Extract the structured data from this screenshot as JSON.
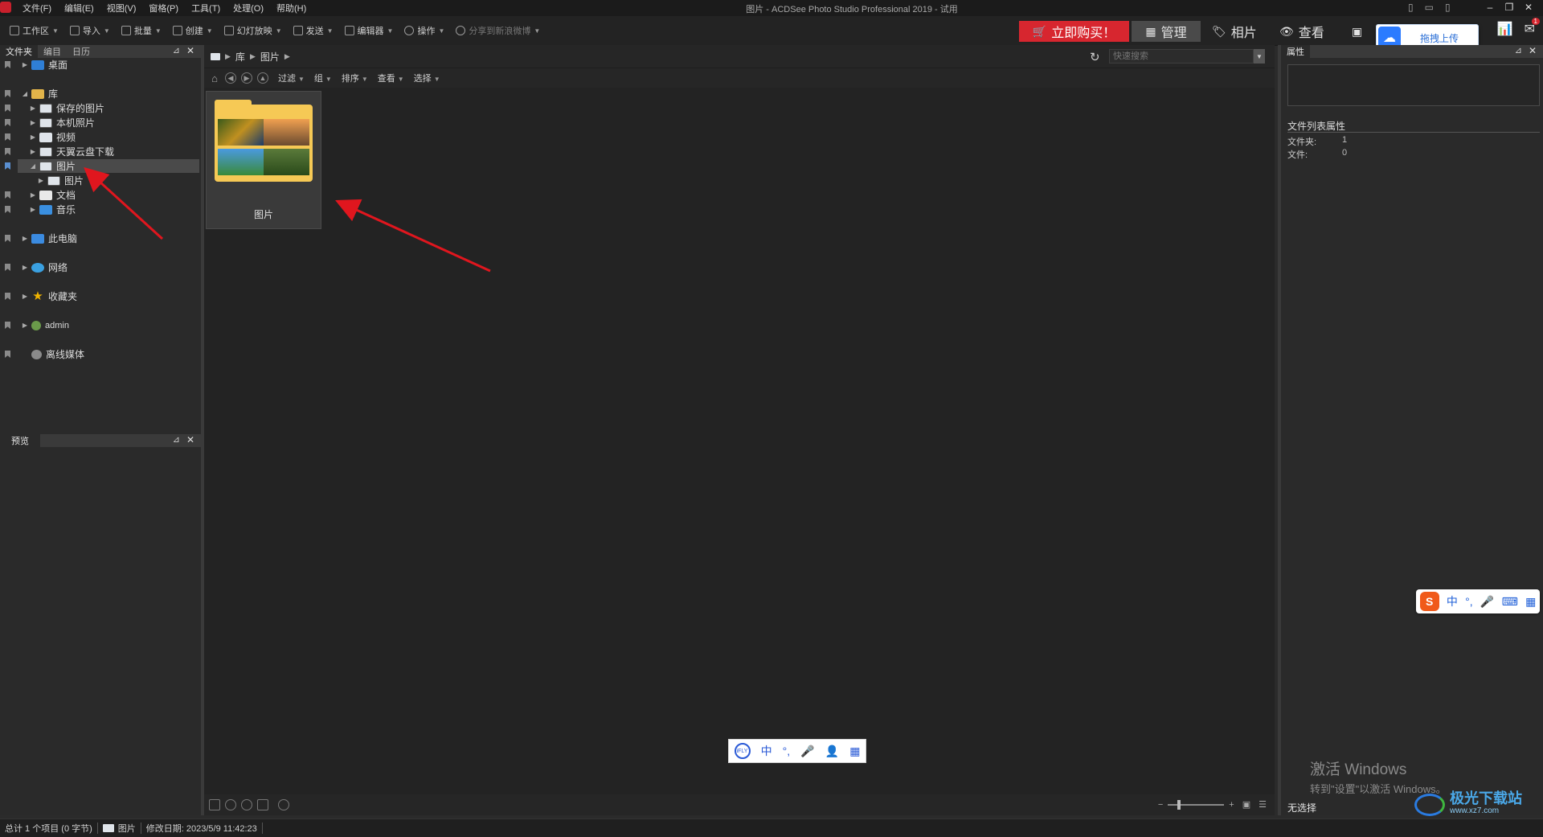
{
  "window": {
    "title": "图片 - ACDSee Photo Studio Professional 2019 - 试用",
    "controls": [
      "–",
      "❐",
      "✕"
    ]
  },
  "menu": [
    "文件(F)",
    "编辑(E)",
    "视图(V)",
    "窗格(P)",
    "工具(T)",
    "处理(O)",
    "帮助(H)"
  ],
  "toolbar": {
    "items": [
      {
        "label": "工作区",
        "dropdown": true
      },
      {
        "label": "导入",
        "dropdown": true
      },
      {
        "label": "批量",
        "dropdown": true
      },
      {
        "label": "创建",
        "dropdown": true
      },
      {
        "label": "幻灯放映",
        "dropdown": true
      },
      {
        "label": "发送",
        "dropdown": true
      },
      {
        "label": "编辑器",
        "dropdown": true
      },
      {
        "label": "操作",
        "dropdown": true
      },
      {
        "label": "分享到新浪微博",
        "dropdown": true
      }
    ],
    "buy_label": "立即购买！",
    "modes": {
      "manage": "管理",
      "photos": "相片",
      "view": "查看"
    },
    "upload_label": "拖拽上传",
    "badge": "1",
    "colors": {
      "buy": "#d7262f",
      "accent": "#2b7bff"
    }
  },
  "left_panel": {
    "tabs": [
      "文件夹",
      "编目",
      "日历"
    ],
    "pin": "⊿",
    "close": "✕",
    "tree": [
      {
        "label": "桌面",
        "icon": "desktop-icon"
      },
      {
        "label": "库",
        "icon": "library-icon"
      },
      {
        "label": "保存的图片",
        "icon": "folder-icon"
      },
      {
        "label": "本机照片",
        "icon": "folder-icon"
      },
      {
        "label": "视频",
        "icon": "video-icon"
      },
      {
        "label": "天翼云盘下载",
        "icon": "folder-icon"
      },
      {
        "label": "图片",
        "icon": "folder-icon",
        "selected": true
      },
      {
        "label": "图片",
        "icon": "folder-icon"
      },
      {
        "label": "文档",
        "icon": "document-icon"
      },
      {
        "label": "音乐",
        "icon": "music-icon"
      },
      {
        "label": "此电脑",
        "icon": "computer-icon"
      },
      {
        "label": "网络",
        "icon": "network-icon"
      },
      {
        "label": "收藏夹",
        "icon": "star-icon"
      },
      {
        "label": "admin",
        "icon": "user-icon"
      },
      {
        "label": "离线媒体",
        "icon": "offline-media-icon"
      }
    ],
    "preview_tab": "预览"
  },
  "center": {
    "breadcrumb": [
      "库",
      "图片"
    ],
    "search_placeholder": "快速搜索",
    "filter_items": [
      "过滤",
      "组",
      "排序",
      "查看",
      "选择"
    ],
    "thumbnail_label": "图片"
  },
  "right_panel": {
    "title": "属性",
    "section": "文件列表属性",
    "folders_label": "文件夹:",
    "folders_value": "1",
    "files_label": "文件:",
    "files_value": "0",
    "no_selection": "无选择",
    "activate_line1": "激活 Windows",
    "activate_line2": "转到\"设置\"以激活 Windows。"
  },
  "statusbar": {
    "total": "总计 1 个项目 (0 字节)",
    "folder": "图片",
    "modified": "修改日期: 2023/5/9 11:42:23"
  },
  "ime": {
    "chars": [
      "中",
      "°,",
      "🎤",
      "👤",
      "▦"
    ],
    "logo": "iFLY"
  },
  "sogou": {
    "logo": "S",
    "chars": [
      "中",
      "°,",
      "🎤",
      "⌨",
      "▦"
    ]
  },
  "watermark": {
    "name": "极光下载站",
    "url": "www.xz7.com"
  }
}
